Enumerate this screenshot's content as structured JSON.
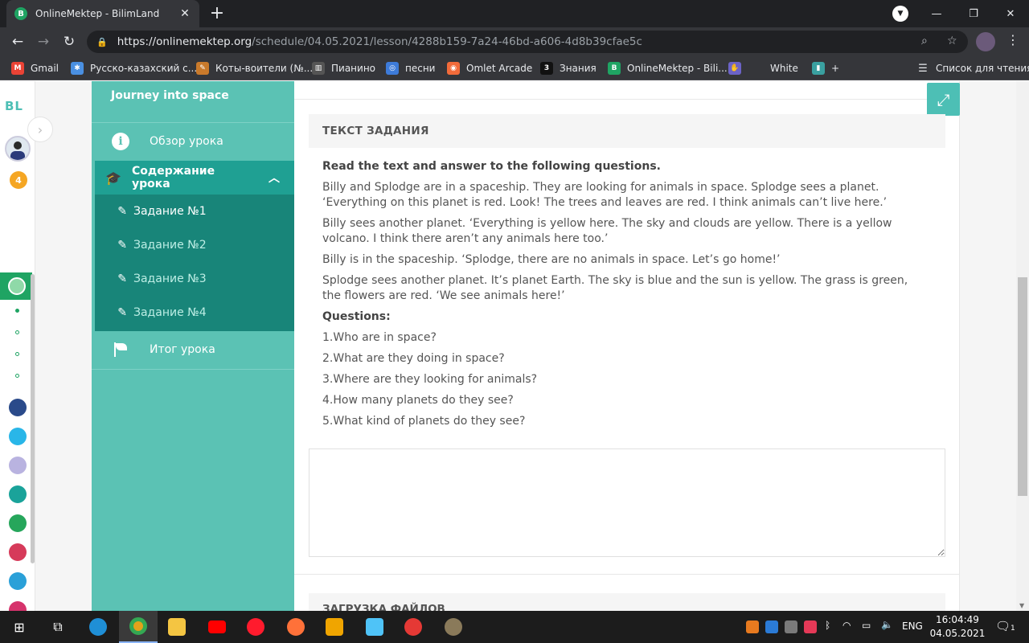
{
  "browser": {
    "tab_title": "OnlineMektep - BilimLand",
    "tab_favicon_letter": "B",
    "url_host": "https://onlinemektep.org",
    "url_path": "/schedule/04.05.2021/lesson/4288b159-7a24-46bd-a606-4d8b39cfae5c",
    "bookmarks": [
      {
        "label": "Gmail",
        "color": "#ea4335",
        "glyph": "M"
      },
      {
        "label": "Русско-казахский с...",
        "color": "#4a90e2",
        "glyph": "✱"
      },
      {
        "label": "Коты-воители (№...",
        "color": "#c97a2b",
        "glyph": "✎"
      },
      {
        "label": "Пианино",
        "color": "#555555",
        "glyph": "▥"
      },
      {
        "label": "песни",
        "color": "#3d7bd9",
        "glyph": "◎"
      },
      {
        "label": "Omlet Arcade",
        "color": "#f26b3a",
        "glyph": "◉"
      },
      {
        "label": "Знания",
        "color": "#111111",
        "glyph": "3"
      },
      {
        "label": "OnlineMektep - Bili...",
        "color": "#1fa463",
        "glyph": "B"
      },
      {
        "label": "",
        "color": "#6c63c7",
        "glyph": "✋"
      },
      {
        "label": "White",
        "color": "#35363a",
        "glyph": ""
      },
      {
        "label": "+",
        "color": "#3aa0a0",
        "glyph": "▮"
      }
    ],
    "reading_list": "Список для чтения"
  },
  "rail": {
    "logo": "BL",
    "badge": "4",
    "apps": [
      "#2a4a8a",
      "#29b6e8",
      "#b9b3e0",
      "#1aa39a",
      "#26a65b",
      "#d63a5a",
      "#2aa0d8",
      "#d6336c"
    ]
  },
  "sidebar": {
    "lesson_title": "Journey into space",
    "overview": "Обзор урока",
    "content": "Содержание урока",
    "tasks": [
      "Задание №1",
      "Задание №2",
      "Задание №3",
      "Задание №4"
    ],
    "result": "Итог урока"
  },
  "task": {
    "header": "ТЕКСТ ЗАДАНИЯ",
    "instruction": "Read the text and answer to the following questions.",
    "paragraphs": [
      "Billy and Splodge are in a spaceship. They are looking for animals in space. Splodge sees a planet. ‘Everything on this planet is red. Look! The trees and leaves are red. I think animals can’t live here.’",
      "Billy sees another planet. ‘Everything is yellow here. The sky and clouds are yellow. There is a yellow volcano. I think there aren’t any animals here too.’",
      "Billy is in the spaceship. ‘Splodge, there are no animals in space. Let’s go home!’",
      "Splodge sees another planet. It’s planet Earth. The sky is blue and the sun is yellow. The grass is green, the flowers are red. ‘We see animals here!’"
    ],
    "questions_label": "Questions:",
    "questions": [
      "1.Who are in space?",
      "2.What are they doing in space?",
      "3.Where are they looking for animals?",
      "4.How many planets do they see?",
      "5.What kind of planets do they see?"
    ],
    "answer_value": "",
    "upload_header": "ЗАГРУЗКА ФАЙЛОВ"
  },
  "taskbar": {
    "language": "ENG",
    "time": "16:04:49",
    "date": "04.05.2021",
    "notifications": "1"
  }
}
